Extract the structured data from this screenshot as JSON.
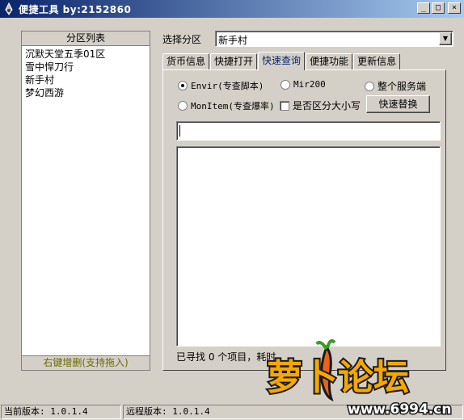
{
  "window": {
    "title": "便捷工具  by:2152860",
    "controls": {
      "minimize": "_",
      "maximize": "□",
      "close": "×"
    }
  },
  "zones": {
    "header": "分区列表",
    "items": [
      "沉默天堂五季01区",
      "雪中悍刀行",
      "新手村",
      "梦幻西游"
    ],
    "footer": "右键增删(支持拖入)"
  },
  "zone_select": {
    "label": "选择分区",
    "value": "新手村"
  },
  "tabs": [
    "货币信息",
    "快捷打开",
    "快速查询",
    "便捷功能",
    "更新信息"
  ],
  "active_tab": "快速查询",
  "options": {
    "envir": "Envir(专查脚本)",
    "mir200": "Mir200",
    "server": "整个服务端",
    "monitem": "MonItem(专查爆率)",
    "case_sensitive": "是否区分大小写",
    "replace_button": "快速替换",
    "selected": "envir"
  },
  "search": {
    "value": ""
  },
  "status": {
    "line": "已寻找 0 个项目，耗时"
  },
  "statusbar": {
    "current_version": "当前版本: 1.0.1.4",
    "remote_version": "远程版本: 1.0.1.4"
  },
  "watermark": {
    "text": "萝卜论坛",
    "url": "www.6994.cn"
  },
  "colors": {
    "titlebar_start": "#0a246a",
    "titlebar_end": "#a6caf0",
    "face": "#d4d0c8",
    "watermark": "#f5a800"
  }
}
